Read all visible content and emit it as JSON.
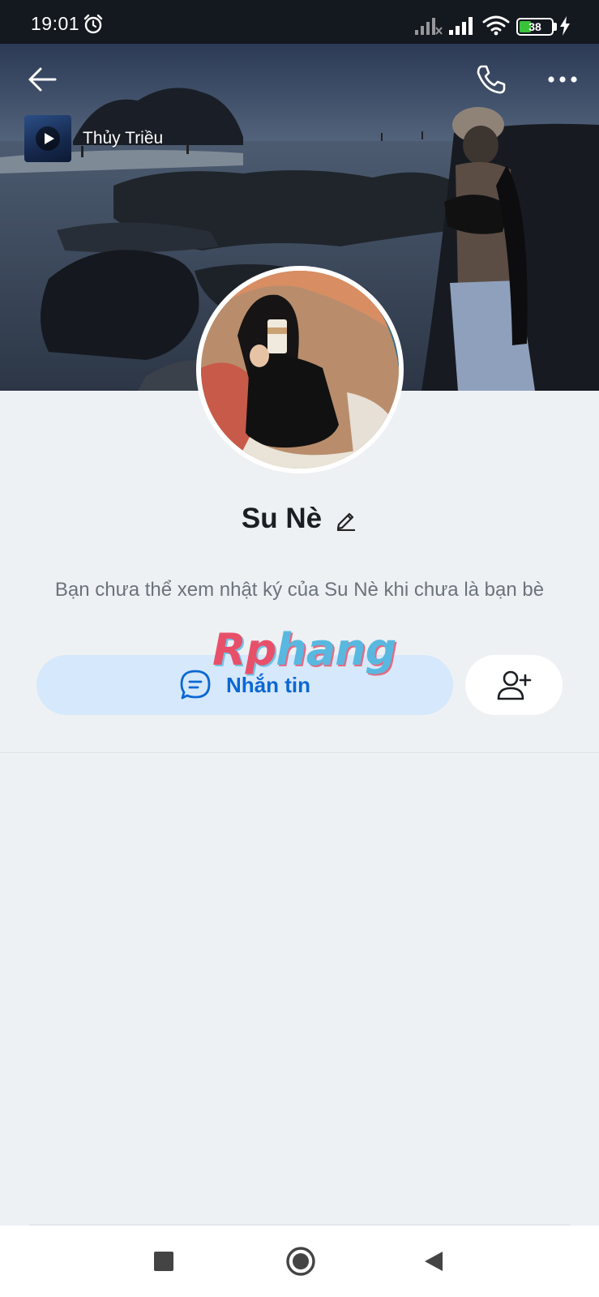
{
  "status_bar": {
    "time": "19:01",
    "battery_level": "38",
    "battery_fraction": 0.38,
    "icons": [
      "alarm-icon",
      "cellular-signal-icon",
      "cellular-signal-icon",
      "wifi-icon",
      "battery-icon",
      "charging-bolt-icon"
    ]
  },
  "header": {
    "icons": [
      "arrow-left-icon",
      "phone-icon",
      "more-horizontal-icon"
    ]
  },
  "music": {
    "title": "Thủy Triều",
    "icon": "play-icon"
  },
  "profile": {
    "name": "Su Nè",
    "edit_icon": "pencil-icon",
    "notice": "Bạn chưa thể xem nhật ký của Su Nè khi chưa là bạn bè"
  },
  "actions": {
    "message_label": "Nhắn tin",
    "message_icon": "chat-bubble-icon",
    "add_friend_icon": "add-friend-icon"
  },
  "watermark": {
    "part_a": "Rp",
    "part_b": "hang"
  },
  "colors": {
    "accent": "#0a68d4",
    "message_button_bg": "#d6e8fb",
    "page_bg": "#eef1f4",
    "status_bar_bg": "#14181f"
  },
  "nav": {
    "icons": [
      "recent-apps-icon",
      "home-icon",
      "back-triangle-icon"
    ]
  }
}
